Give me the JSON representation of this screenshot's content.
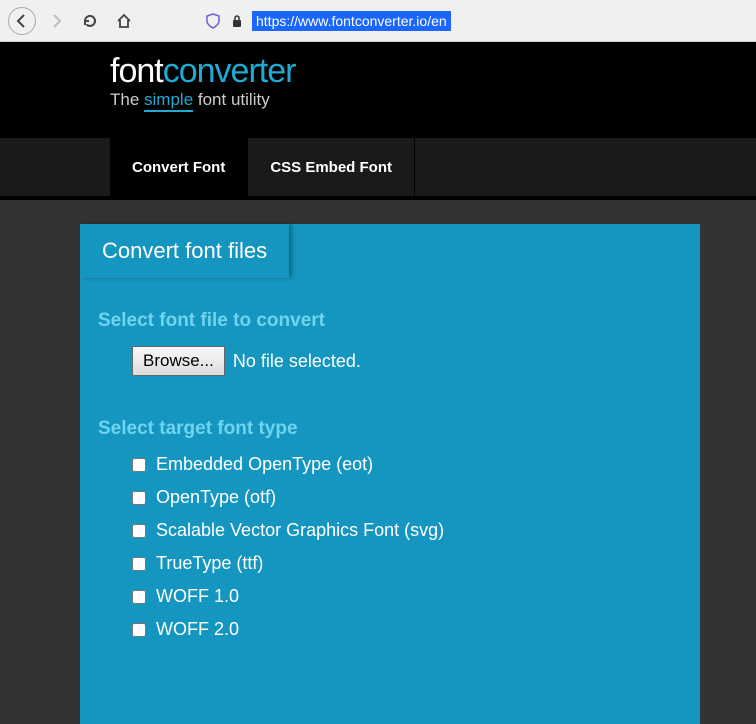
{
  "browser": {
    "url": "https://www.fontconverter.io/en"
  },
  "header": {
    "logo_part1": "font",
    "logo_part2": "converter",
    "tagline_pre": "The ",
    "tagline_em": "simple",
    "tagline_post": " font utility"
  },
  "nav": {
    "tabs": [
      {
        "label": "Convert Font",
        "active": true
      },
      {
        "label": "CSS Embed Font",
        "active": false
      }
    ]
  },
  "panel": {
    "title": "Convert font files",
    "file_section_label": "Select font file to convert",
    "browse_label": "Browse...",
    "file_status": "No file selected.",
    "type_section_label": "Select target font type",
    "types": [
      "Embedded OpenType (eot)",
      "OpenType (otf)",
      "Scalable Vector Graphics Font (svg)",
      "TrueType (ttf)",
      "WOFF 1.0",
      "WOFF 2.0"
    ]
  }
}
